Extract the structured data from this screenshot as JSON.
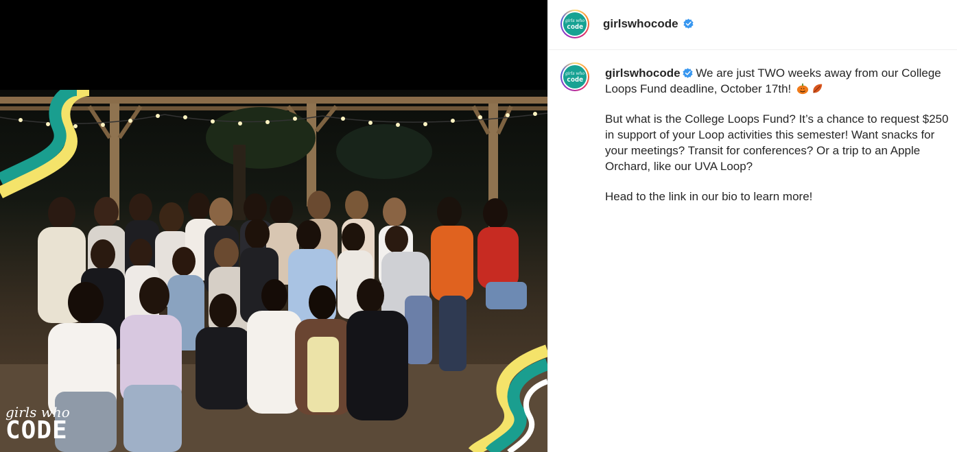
{
  "post": {
    "image_alt": "Group photo of Girls Who Code UVA Loop members at night under string lights",
    "watermark_text": "girls who CODE"
  },
  "header": {
    "username": "girlswhocode",
    "avatar_label": "girlswhocode",
    "verified": true
  },
  "caption": {
    "username": "girlswhocode",
    "line1": "We are just TWO weeks away from our College Loops Fund deadline, October 17th!",
    "emoji": [
      "pumpkin-icon",
      "leaf-icon"
    ],
    "paragraph2": "But what is the College Loops Fund? It’s a chance to request $250 in support of your Loop activities this semester! Want snacks for your meetings? Transit for conferences? Or a trip to an Apple Orchard, like our UVA Loop?",
    "paragraph3": "Head to the link in our bio to learn more!"
  },
  "colors": {
    "brand_teal": "#17a293",
    "verified_blue": "#3897f0",
    "wave_yellow": "#f4e36a",
    "wave_teal": "#1a9e8f"
  }
}
